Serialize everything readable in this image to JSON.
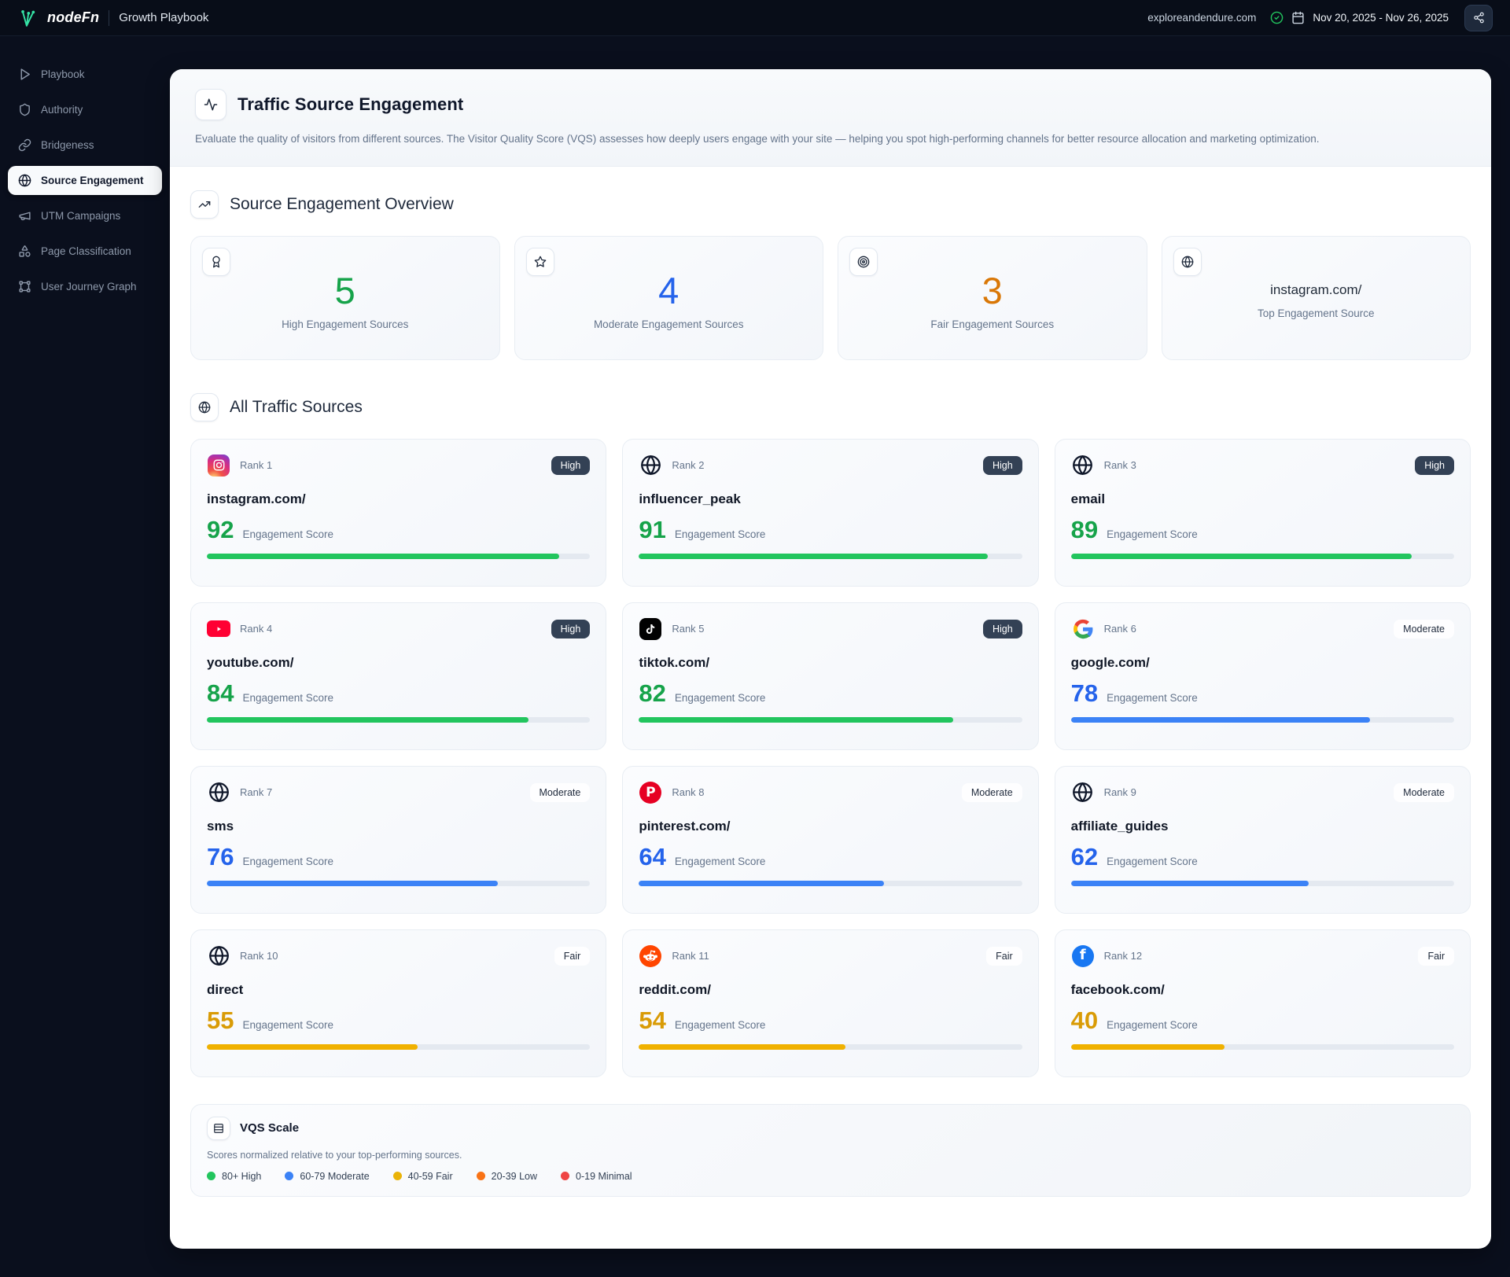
{
  "topbar": {
    "brand": "nodeFn",
    "app_title": "Growth Playbook",
    "domain": "exploreandendure.com",
    "date_range": "Nov 20, 2025 - Nov 26, 2025"
  },
  "sidebar": {
    "items": [
      {
        "label": "Playbook",
        "icon": "play",
        "active": false
      },
      {
        "label": "Authority",
        "icon": "shield",
        "active": false
      },
      {
        "label": "Bridgeness",
        "icon": "link",
        "active": false
      },
      {
        "label": "Source Engagement",
        "icon": "globe",
        "active": true
      },
      {
        "label": "UTM Campaigns",
        "icon": "megaphone",
        "active": false
      },
      {
        "label": "Page Classification",
        "icon": "shapes",
        "active": false
      },
      {
        "label": "User Journey Graph",
        "icon": "journey",
        "active": false
      }
    ]
  },
  "page": {
    "title": "Traffic Source Engagement",
    "description": "Evaluate the quality of visitors from different sources. The Visitor Quality Score (VQS) assesses how deeply users engage with your site — helping you spot high-performing channels for better resource allocation and marketing optimization."
  },
  "overview": {
    "section_title": "Source Engagement Overview",
    "cards": [
      {
        "kind": "number",
        "icon": "award",
        "value": "5",
        "label": "High Engagement Sources",
        "color": "#16a34a"
      },
      {
        "kind": "number",
        "icon": "star",
        "value": "4",
        "label": "Moderate Engagement Sources",
        "color": "#2563eb"
      },
      {
        "kind": "number",
        "icon": "target",
        "value": "3",
        "label": "Fair Engagement Sources",
        "color": "#d97706"
      },
      {
        "kind": "text",
        "icon": "globe",
        "value": "instagram.com/",
        "label": "Top Engagement Source",
        "color": ""
      }
    ]
  },
  "sources": {
    "section_title": "All Traffic Sources",
    "score_label": "Engagement Score",
    "items": [
      {
        "rank": "Rank 1",
        "name": "instagram.com/",
        "score": 92,
        "tier": "High",
        "brand": "instagram"
      },
      {
        "rank": "Rank 2",
        "name": "influencer_peak",
        "score": 91,
        "tier": "High",
        "brand": "globe"
      },
      {
        "rank": "Rank 3",
        "name": "email",
        "score": 89,
        "tier": "High",
        "brand": "globe"
      },
      {
        "rank": "Rank 4",
        "name": "youtube.com/",
        "score": 84,
        "tier": "High",
        "brand": "youtube"
      },
      {
        "rank": "Rank 5",
        "name": "tiktok.com/",
        "score": 82,
        "tier": "High",
        "brand": "tiktok"
      },
      {
        "rank": "Rank 6",
        "name": "google.com/",
        "score": 78,
        "tier": "Moderate",
        "brand": "google"
      },
      {
        "rank": "Rank 7",
        "name": "sms",
        "score": 76,
        "tier": "Moderate",
        "brand": "globe"
      },
      {
        "rank": "Rank 8",
        "name": "pinterest.com/",
        "score": 64,
        "tier": "Moderate",
        "brand": "pinterest"
      },
      {
        "rank": "Rank 9",
        "name": "affiliate_guides",
        "score": 62,
        "tier": "Moderate",
        "brand": "globe"
      },
      {
        "rank": "Rank 10",
        "name": "direct",
        "score": 55,
        "tier": "Fair",
        "brand": "globe"
      },
      {
        "rank": "Rank 11",
        "name": "reddit.com/",
        "score": 54,
        "tier": "Fair",
        "brand": "reddit"
      },
      {
        "rank": "Rank 12",
        "name": "facebook.com/",
        "score": 40,
        "tier": "Fair",
        "brand": "facebook"
      }
    ],
    "tiers": {
      "High": {
        "text": "#16a34a",
        "bar": "#22c55e",
        "badge": "dark"
      },
      "Moderate": {
        "text": "#2563eb",
        "bar": "#3b82f6",
        "badge": "light"
      },
      "Fair": {
        "text": "#d99b06",
        "bar": "#f0b100",
        "badge": "light"
      }
    }
  },
  "vqs": {
    "title": "VQS Scale",
    "subtitle": "Scores normalized relative to your top-performing sources.",
    "legend": [
      {
        "label": "80+ High",
        "color": "#22c55e"
      },
      {
        "label": "60-79 Moderate",
        "color": "#3b82f6"
      },
      {
        "label": "40-59 Fair",
        "color": "#eab308"
      },
      {
        "label": "20-39 Low",
        "color": "#f97316"
      },
      {
        "label": "0-19 Minimal",
        "color": "#ef4444"
      }
    ]
  }
}
